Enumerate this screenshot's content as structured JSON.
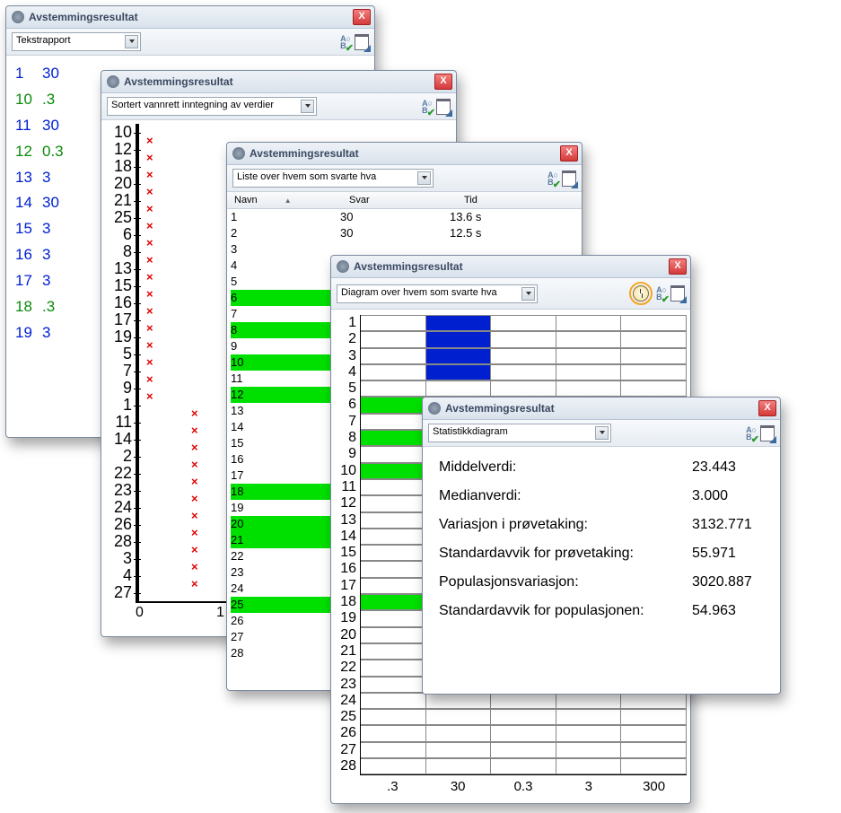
{
  "windows": {
    "title": "Avstemmingsresultat",
    "close_label": "X"
  },
  "win1": {
    "combo": "Tekstrapport",
    "rows": [
      {
        "n": "1",
        "v": "30",
        "cls": "blue"
      },
      {
        "n": "10",
        "v": ".3",
        "cls": "green"
      },
      {
        "n": "11",
        "v": "30",
        "cls": "blue"
      },
      {
        "n": "12",
        "v": "0.3",
        "cls": "green"
      },
      {
        "n": "13",
        "v": "3",
        "cls": "blue"
      },
      {
        "n": "14",
        "v": "30",
        "cls": "blue"
      },
      {
        "n": "15",
        "v": "3",
        "cls": "blue"
      },
      {
        "n": "16",
        "v": "3",
        "cls": "blue"
      },
      {
        "n": "17",
        "v": "3",
        "cls": "blue"
      },
      {
        "n": "18",
        "v": ".3",
        "cls": "green"
      },
      {
        "n": "19",
        "v": "3",
        "cls": "blue"
      }
    ]
  },
  "win2": {
    "combo": "Sortert vannrett inntegning av verdier",
    "rows": [
      {
        "lbl": "10",
        "x": 0
      },
      {
        "lbl": "12",
        "x": 0
      },
      {
        "lbl": "18",
        "x": 0
      },
      {
        "lbl": "20",
        "x": 0
      },
      {
        "lbl": "21",
        "x": 0
      },
      {
        "lbl": "25",
        "x": 0
      },
      {
        "lbl": "6",
        "x": 0
      },
      {
        "lbl": "8",
        "x": 0
      },
      {
        "lbl": "13",
        "x": 0
      },
      {
        "lbl": "15",
        "x": 0
      },
      {
        "lbl": "16",
        "x": 0
      },
      {
        "lbl": "17",
        "x": 0
      },
      {
        "lbl": "19",
        "x": 0
      },
      {
        "lbl": "5",
        "x": 0
      },
      {
        "lbl": "7",
        "x": 0
      },
      {
        "lbl": "9",
        "x": 0
      },
      {
        "lbl": "1",
        "x": 1
      },
      {
        "lbl": "11",
        "x": 1
      },
      {
        "lbl": "14",
        "x": 1
      },
      {
        "lbl": "2",
        "x": 1
      },
      {
        "lbl": "22",
        "x": 1
      },
      {
        "lbl": "23",
        "x": 1
      },
      {
        "lbl": "24",
        "x": 1
      },
      {
        "lbl": "26",
        "x": 1
      },
      {
        "lbl": "28",
        "x": 1
      },
      {
        "lbl": "3",
        "x": 1
      },
      {
        "lbl": "4",
        "x": 1
      },
      {
        "lbl": "27",
        "x": null
      }
    ],
    "xticks": [
      "0",
      "1"
    ]
  },
  "win3": {
    "combo": "Liste over hvem som svarte hva",
    "headers": {
      "navn": "Navn",
      "svar": "Svar",
      "tid": "Tid"
    },
    "rows": [
      {
        "n": "1",
        "s": "30",
        "t": "13.6 s",
        "g": false
      },
      {
        "n": "2",
        "s": "30",
        "t": "12.5 s",
        "g": false
      },
      {
        "n": "3",
        "s": "",
        "t": "",
        "g": false
      },
      {
        "n": "4",
        "s": "",
        "t": "",
        "g": false
      },
      {
        "n": "5",
        "s": "",
        "t": "",
        "g": false
      },
      {
        "n": "6",
        "s": "",
        "t": "",
        "g": true
      },
      {
        "n": "7",
        "s": "",
        "t": "",
        "g": false
      },
      {
        "n": "8",
        "s": "",
        "t": "",
        "g": true
      },
      {
        "n": "9",
        "s": "",
        "t": "",
        "g": false
      },
      {
        "n": "10",
        "s": "",
        "t": "",
        "g": true
      },
      {
        "n": "11",
        "s": "",
        "t": "",
        "g": false
      },
      {
        "n": "12",
        "s": "",
        "t": "",
        "g": true
      },
      {
        "n": "13",
        "s": "",
        "t": "",
        "g": false
      },
      {
        "n": "14",
        "s": "",
        "t": "",
        "g": false
      },
      {
        "n": "15",
        "s": "",
        "t": "",
        "g": false
      },
      {
        "n": "16",
        "s": "",
        "t": "",
        "g": false
      },
      {
        "n": "17",
        "s": "",
        "t": "",
        "g": false
      },
      {
        "n": "18",
        "s": "",
        "t": "",
        "g": true
      },
      {
        "n": "19",
        "s": "",
        "t": "",
        "g": false
      },
      {
        "n": "20",
        "s": "",
        "t": "",
        "g": true
      },
      {
        "n": "21",
        "s": "",
        "t": "",
        "g": true
      },
      {
        "n": "22",
        "s": "",
        "t": "",
        "g": false
      },
      {
        "n": "23",
        "s": "",
        "t": "",
        "g": false
      },
      {
        "n": "24",
        "s": "",
        "t": "",
        "g": false
      },
      {
        "n": "25",
        "s": "",
        "t": "",
        "g": true
      },
      {
        "n": "26",
        "s": "",
        "t": "",
        "g": false
      },
      {
        "n": "27",
        "s": "",
        "t": "",
        "g": false
      },
      {
        "n": "28",
        "s": "",
        "t": "",
        "g": false
      }
    ]
  },
  "win4": {
    "combo": "Diagram over hvem som svarte hva",
    "rows": [
      {
        "n": "1",
        "c": "blue"
      },
      {
        "n": "2",
        "c": "blue"
      },
      {
        "n": "3",
        "c": "blue"
      },
      {
        "n": "4",
        "c": "blue"
      },
      {
        "n": "5",
        "c": ""
      },
      {
        "n": "6",
        "c": "green"
      },
      {
        "n": "7",
        "c": ""
      },
      {
        "n": "8",
        "c": "green"
      },
      {
        "n": "9",
        "c": ""
      },
      {
        "n": "10",
        "c": "green"
      },
      {
        "n": "11",
        "c": ""
      },
      {
        "n": "12",
        "c": ""
      },
      {
        "n": "13",
        "c": ""
      },
      {
        "n": "14",
        "c": ""
      },
      {
        "n": "15",
        "c": ""
      },
      {
        "n": "16",
        "c": ""
      },
      {
        "n": "17",
        "c": ""
      },
      {
        "n": "18",
        "c": "green"
      },
      {
        "n": "19",
        "c": ""
      },
      {
        "n": "20",
        "c": ""
      },
      {
        "n": "21",
        "c": ""
      },
      {
        "n": "22",
        "c": ""
      },
      {
        "n": "23",
        "c": ""
      },
      {
        "n": "24",
        "c": ""
      },
      {
        "n": "25",
        "c": ""
      },
      {
        "n": "26",
        "c": ""
      },
      {
        "n": "27",
        "c": ""
      },
      {
        "n": "28",
        "c": ""
      }
    ],
    "xticks": [
      ".3",
      "30",
      "0.3",
      "3",
      "300"
    ]
  },
  "win5": {
    "combo": "Statistikkdiagram",
    "stats": [
      {
        "label": "Middelverdi:",
        "value": "23.443"
      },
      {
        "label": "Medianverdi:",
        "value": "3.000"
      },
      {
        "label": "Variasjon i prøvetaking:",
        "value": "3132.771"
      },
      {
        "label": "Standardavvik for prøvetaking:",
        "value": "55.971"
      },
      {
        "label": "Populasjonsvariasjon:",
        "value": "3020.887"
      },
      {
        "label": "Standardavvik for populasjonen:",
        "value": "54.963"
      }
    ]
  },
  "chart_data": [
    {
      "type": "table",
      "title": "Tekstrapport",
      "columns": [
        "id",
        "value"
      ],
      "rows": [
        [
          "1",
          "30"
        ],
        [
          "10",
          ".3"
        ],
        [
          "11",
          "30"
        ],
        [
          "12",
          "0.3"
        ],
        [
          "13",
          "3"
        ],
        [
          "14",
          "30"
        ],
        [
          "15",
          "3"
        ],
        [
          "16",
          "3"
        ],
        [
          "17",
          "3"
        ],
        [
          "18",
          ".3"
        ],
        [
          "19",
          "3"
        ]
      ]
    },
    {
      "type": "scatter",
      "title": "Sortert vannrett inntegning av verdier",
      "x": [
        0,
        0,
        0,
        0,
        0,
        0,
        0,
        0,
        0,
        0,
        0,
        0,
        0,
        0,
        0,
        0,
        1,
        1,
        1,
        1,
        1,
        1,
        1,
        1,
        1,
        1,
        1
      ],
      "categories": [
        "10",
        "12",
        "18",
        "20",
        "21",
        "25",
        "6",
        "8",
        "13",
        "15",
        "16",
        "17",
        "19",
        "5",
        "7",
        "9",
        "1",
        "11",
        "14",
        "2",
        "22",
        "23",
        "24",
        "26",
        "28",
        "3",
        "4"
      ],
      "xlim": [
        0,
        1
      ]
    },
    {
      "type": "table",
      "title": "Liste over hvem som svarte hva",
      "columns": [
        "Navn",
        "Svar",
        "Tid"
      ],
      "rows": [
        [
          "1",
          "30",
          "13.6 s"
        ],
        [
          "2",
          "30",
          "12.5 s"
        ]
      ],
      "highlighted_rows": [
        "6",
        "8",
        "10",
        "12",
        "18",
        "20",
        "21",
        "25"
      ]
    },
    {
      "type": "bar",
      "title": "Diagram over hvem som svarte hva",
      "categories": [
        "1",
        "2",
        "3",
        "4",
        "5",
        "6",
        "7",
        "8",
        "9",
        "10",
        "11",
        "12",
        "13",
        "14",
        "15",
        "16",
        "17",
        "18",
        "19",
        "20",
        "21",
        "22",
        "23",
        "24",
        "25",
        "26",
        "27",
        "28"
      ],
      "series": [
        {
          "name": "30",
          "members": [
            "1",
            "2",
            "3",
            "4"
          ]
        },
        {
          "name": ".3",
          "members": [
            "6",
            "8",
            "10",
            "18"
          ]
        }
      ],
      "xticks": [
        ".3",
        "30",
        "0.3",
        "3",
        "300"
      ]
    },
    {
      "type": "table",
      "title": "Statistikkdiagram",
      "rows": [
        [
          "Middelverdi",
          "23.443"
        ],
        [
          "Medianverdi",
          "3.000"
        ],
        [
          "Variasjon i prøvetaking",
          "3132.771"
        ],
        [
          "Standardavvik for prøvetaking",
          "55.971"
        ],
        [
          "Populasjonsvariasjon",
          "3020.887"
        ],
        [
          "Standardavvik for populasjonen",
          "54.963"
        ]
      ]
    }
  ]
}
